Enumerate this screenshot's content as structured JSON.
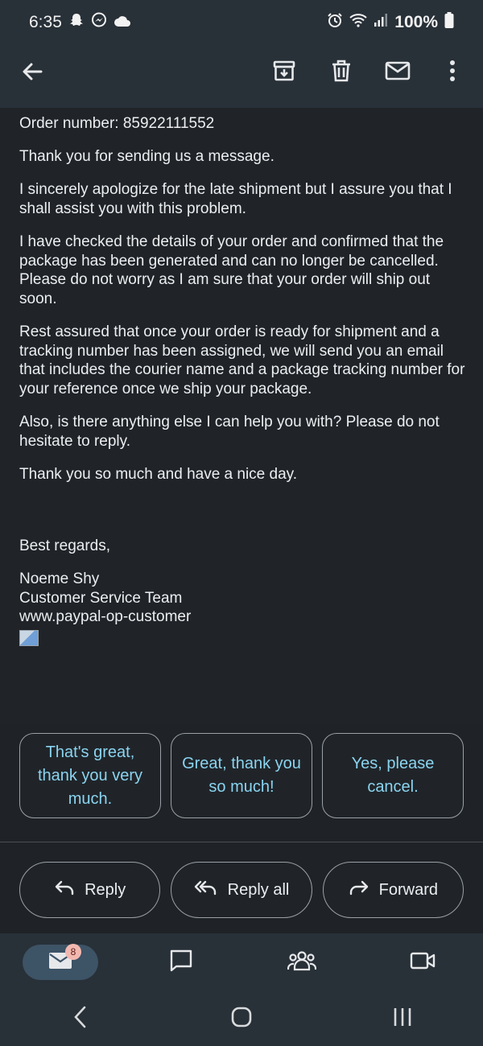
{
  "status": {
    "time": "6:35",
    "battery": "100%",
    "icons_left": [
      "snapchat-icon",
      "messenger-icon",
      "cloud-icon"
    ],
    "icons_right": [
      "alarm-icon",
      "wifi-icon",
      "signal-icon",
      "battery-icon"
    ]
  },
  "toolbar": {
    "icons": [
      "back-arrow-icon",
      "archive-icon",
      "delete-icon",
      "mark-unread-icon",
      "more-icon"
    ]
  },
  "email": {
    "order": "Order number: 85922111552",
    "p1": "Thank you for sending us a message.",
    "p2": "I sincerely apologize for the late shipment but I assure you that I shall assist you with this problem.",
    "p3": "I have checked the details of your order and confirmed that the package has been generated and can no longer be cancelled. Please do not worry as I am sure that your order will ship out soon.",
    "p4": "Rest assured that once your order is ready for shipment and a tracking number has been assigned, we will send you an email that includes the courier name and a package tracking number for your reference once we ship your package.",
    "p5": "Also, is there anything else I can help you with? Please do not hesitate to reply.",
    "p6": "Thank you so much and have a nice day.",
    "regards": "Best regards,",
    "sig_name": "Noeme Shy",
    "sig_team": "Customer Service Team",
    "sig_site": "www.paypal-op-customer"
  },
  "smart_replies": [
    "That's great, thank you very much.",
    "Great, thank you so much!",
    "Yes, please cancel."
  ],
  "actions": {
    "reply": "Reply",
    "reply_all": "Reply all",
    "forward": "Forward"
  },
  "bottom_nav": {
    "mail_badge": "8",
    "items": [
      "mail-icon",
      "chat-icon",
      "spaces-icon",
      "meet-icon"
    ]
  },
  "colors": {
    "background": "#202429",
    "bar": "#283038",
    "accent": "#8ad4f0",
    "active_nav": "#3d5366",
    "badge": "#f2b8b0"
  }
}
